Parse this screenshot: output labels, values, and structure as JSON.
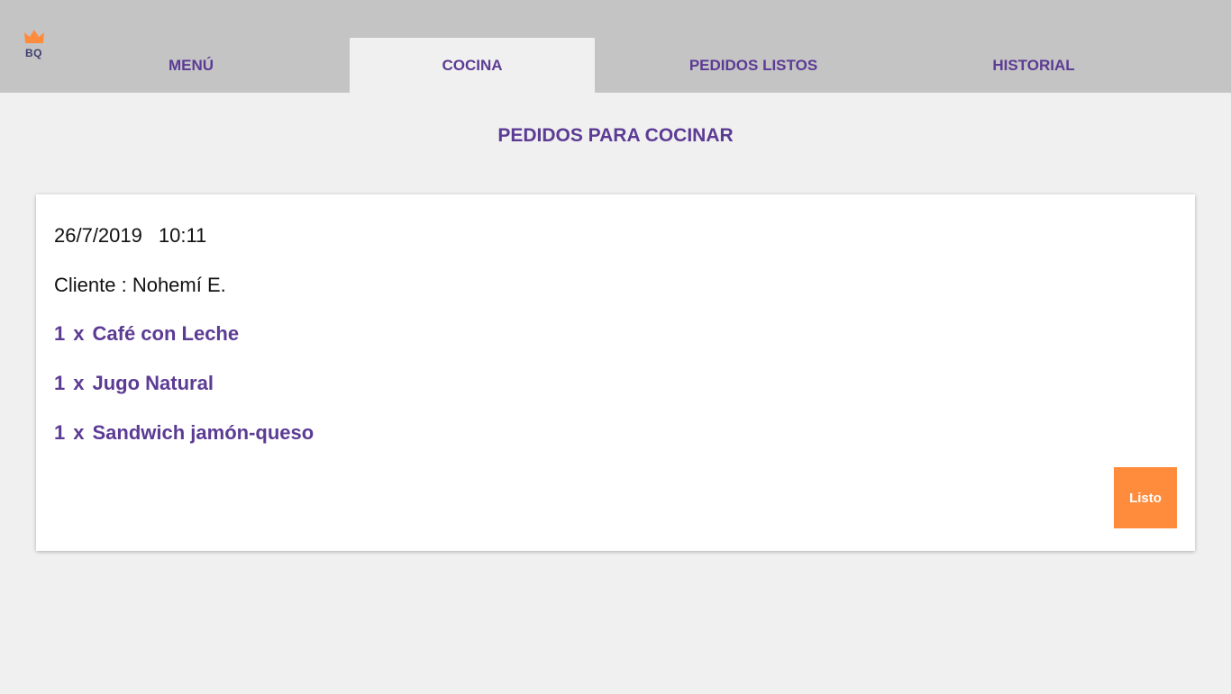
{
  "logo": {
    "text": "BQ",
    "icon": "crown-icon",
    "crown_color": "#ff8c3d"
  },
  "nav": {
    "tabs": [
      {
        "label": "MENÚ",
        "active": false
      },
      {
        "label": "COCINA",
        "active": true
      },
      {
        "label": "PEDIDOS LISTOS",
        "active": false
      },
      {
        "label": "HISTORIAL",
        "active": false
      }
    ]
  },
  "main": {
    "title": "PEDIDOS PARA COCINAR",
    "orders": [
      {
        "date": "26/7/2019",
        "time": "10:11",
        "client": "Cliente : Nohemí E.",
        "items": [
          {
            "qty": "1",
            "sep": "x",
            "name": "Café con Leche"
          },
          {
            "qty": "1",
            "sep": "x",
            "name": "Jugo Natural"
          },
          {
            "qty": "1",
            "sep": "x",
            "name": "Sandwich jamón-queso"
          }
        ],
        "action_label": "Listo"
      }
    ]
  },
  "colors": {
    "accent": "#5c3b94",
    "button": "#ff8c3d",
    "topbar": "#c4c4c4",
    "background": "#f0f0f0"
  }
}
